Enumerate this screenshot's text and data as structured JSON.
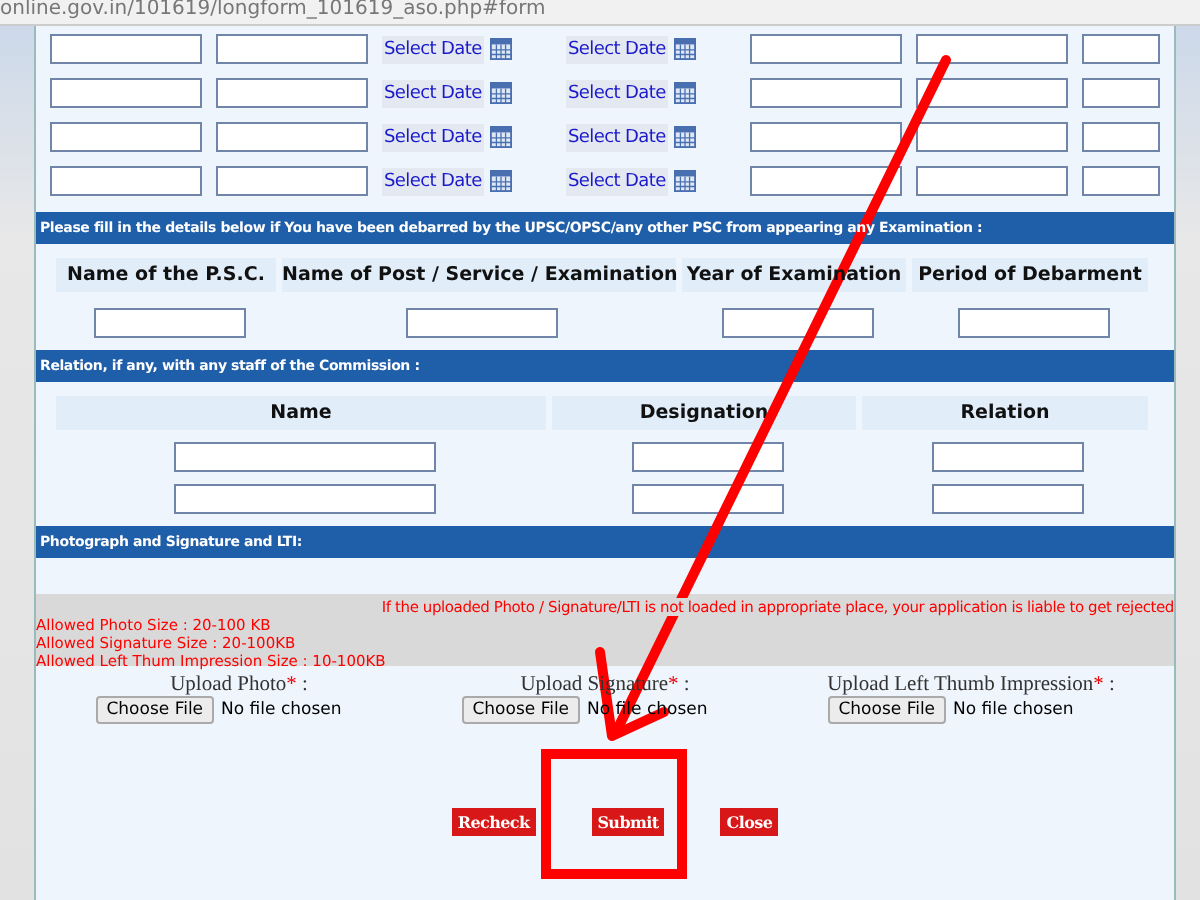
{
  "address_bar": {
    "url": "online.gov.in/101619/longform_101619_aso.php#form"
  },
  "history_rows": [
    {
      "date_buttons": [
        "Select Date",
        "Select Date"
      ]
    },
    {
      "date_buttons": [
        "Select Date",
        "Select Date"
      ]
    },
    {
      "date_buttons": [
        "Select Date",
        "Select Date"
      ]
    },
    {
      "date_buttons": [
        "Select Date",
        "Select Date"
      ]
    }
  ],
  "debarment": {
    "heading": "Please fill in the details below if You have been debarred by the UPSC/OPSC/any other PSC from appearing any Examination :",
    "columns": [
      "Name of the P.S.C.",
      "Name of Post / Service / Examination",
      "Year of Examination",
      "Period of Debarment"
    ]
  },
  "relation": {
    "heading": "Relation, if any, with any staff of the Commission :",
    "columns": [
      "Name",
      "Designation",
      "Relation"
    ]
  },
  "photo": {
    "heading": "Photograph and Signature and LTI:",
    "notice": "If the uploaded Photo / Signature/LTI is not loaded in appropriate place, your application is liable to get rejected",
    "limits": [
      "Allowed Photo Size : 20-100 KB",
      "Allowed Signature Size : 20-100KB",
      "Allowed Left Thum Impression Size : 10-100KB"
    ],
    "uploads": [
      {
        "label": "Upload Photo",
        "required_mark": "*",
        "suffix": " :",
        "button": "Choose File",
        "status": "No file chosen"
      },
      {
        "label": "Upload Signature",
        "required_mark": "*",
        "suffix": " :",
        "button": "Choose File",
        "status": "No file chosen"
      },
      {
        "label": "Upload Left Thumb Impression",
        "required_mark": "*",
        "suffix": " :",
        "button": "Choose File",
        "status": "No file chosen"
      }
    ]
  },
  "buttons": [
    "Recheck",
    "Submit",
    "Close"
  ]
}
